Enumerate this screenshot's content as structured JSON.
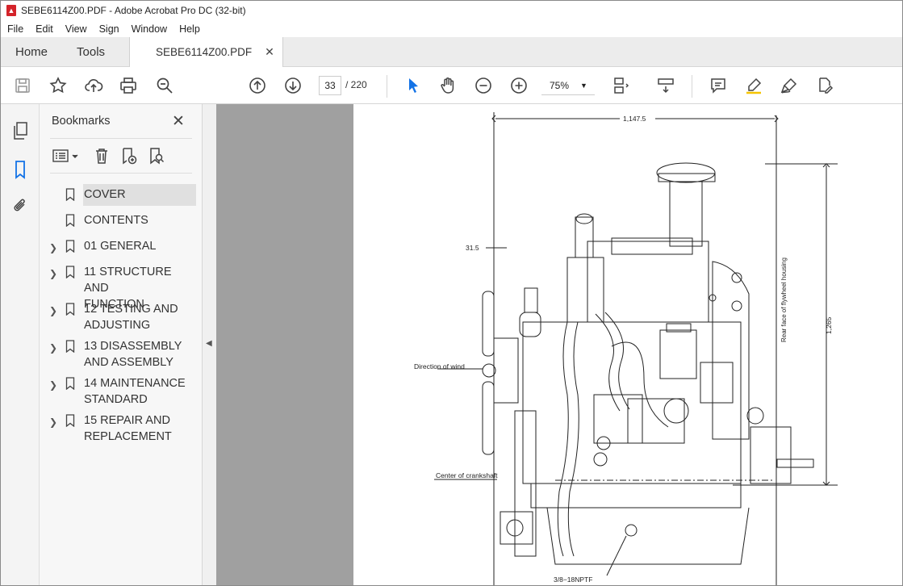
{
  "window": {
    "title": "SEBE6114Z00.PDF - Adobe Acrobat Pro DC (32-bit)"
  },
  "menu": [
    "File",
    "Edit",
    "View",
    "Sign",
    "Window",
    "Help"
  ],
  "tabs": {
    "home": "Home",
    "tools": "Tools",
    "document": "SEBE6114Z00.PDF"
  },
  "toolbar": {
    "current_page": "33",
    "page_total": "/  220",
    "zoom": "75%"
  },
  "bookmarks": {
    "title": "Bookmarks",
    "items": [
      {
        "label": "COVER",
        "expandable": false,
        "selected": true
      },
      {
        "label": "CONTENTS",
        "expandable": false
      },
      {
        "label": "01 GENERAL",
        "expandable": true
      },
      {
        "label": "11 STRUCTURE AND FUNCTION",
        "line1": "11 STRUCTURE AND",
        "line2": "FUNCTION",
        "expandable": true
      },
      {
        "label": "12 TESTING AND ADJUSTING",
        "line1": "12 TESTING AND",
        "line2": "ADJUSTING",
        "expandable": true
      },
      {
        "label": "13 DISASSEMBLY AND ASSEMBLY",
        "line1": "13 DISASSEMBLY",
        "line2": "AND ASSEMBLY",
        "expandable": true
      },
      {
        "label": "14 MAINTENANCE STANDARD",
        "line1": "14 MAINTENANCE",
        "line2": "STANDARD",
        "expandable": true
      },
      {
        "label": "15 REPAIR AND REPLACEMENT",
        "line1": "15 REPAIR AND",
        "line2": "REPLACEMENT",
        "expandable": true
      }
    ]
  },
  "drawing": {
    "dim_width": "1,147.5",
    "dim_offset": "31.5",
    "dim_height": "1,265",
    "label_wind": "Direction of wind",
    "label_crank": "Center of crankshaft",
    "label_thread": "3/8−18NPTF",
    "label_flywheel": "Rear face of flywheel housing"
  }
}
